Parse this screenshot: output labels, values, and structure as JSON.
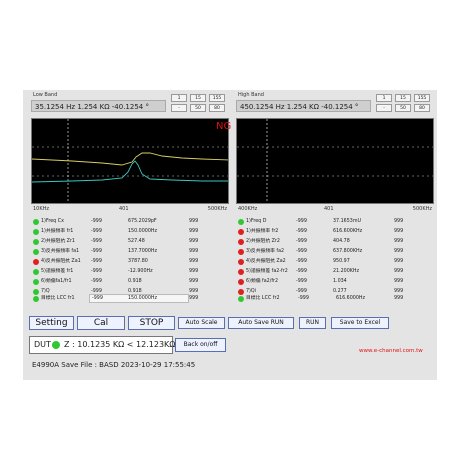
{
  "left_pane": {
    "title": "Low Band",
    "readout": "35.1254 Hz  1.254 KΩ  -40.1254 °",
    "scale_buttons": [
      "1",
      "15",
      "155",
      "-",
      "50",
      "80"
    ],
    "axis_min": "10KHz",
    "axis_mid": "401",
    "axis_max": "500KHz",
    "params": [
      {
        "status": "green",
        "name": "1)Freq Cx",
        "v1": "-999",
        "v2": "675.2029pF",
        "v3": "999"
      },
      {
        "status": "green",
        "name": "1)共振頻率 fr1",
        "v1": "-999",
        "v2": "150.0000Hz",
        "v3": "999"
      },
      {
        "status": "green",
        "name": "2)共振阻抗 Zr1",
        "v1": "-999",
        "v2": "527.48",
        "v3": "999"
      },
      {
        "status": "green",
        "name": "3)反共振頻率 fa1",
        "v1": "-999",
        "v2": "137.7000Hz",
        "v3": "999"
      },
      {
        "status": "red",
        "name": "4)反共振阻抗 Za1",
        "v1": "-999",
        "v2": "3787.80",
        "v3": "999"
      },
      {
        "status": "green",
        "name": "5)諧振頻差 fr1",
        "v1": "-999",
        "v2": "-12.900Hz",
        "v3": "999"
      },
      {
        "status": "green",
        "name": "6)頻偏fa1/fr1",
        "v1": "-999",
        "v2": "0.918",
        "v3": "999"
      },
      {
        "status": "green",
        "name": "7)Q",
        "v1": "-999",
        "v2": "0.918",
        "v3": "999"
      }
    ],
    "judge": {
      "status": "green",
      "label": "目標比 LCC fr1",
      "v1": "-999",
      "v2": "150.0000Hz",
      "v3": "999"
    }
  },
  "right_pane": {
    "title": "High Band",
    "readout": "450.1254 Hz  1.254 KΩ  -40.1254 °",
    "scale_buttons": [
      "1",
      "15",
      "155",
      "-",
      "50",
      "80"
    ],
    "axis_min": "400KHz",
    "axis_mid": "401",
    "axis_max": "500KHz",
    "params": [
      {
        "status": "green",
        "name": "1)Freq D",
        "v1": "-999",
        "v2": "37.1653mU",
        "v3": "999"
      },
      {
        "status": "red",
        "name": "1)共振頻率 fr2",
        "v1": "-999",
        "v2": "616.600KHz",
        "v3": "999"
      },
      {
        "status": "red",
        "name": "2)共振阻抗 Zr2",
        "v1": "-999",
        "v2": "404.78",
        "v3": "999"
      },
      {
        "status": "red",
        "name": "3)反共振頻率 fa2",
        "v1": "-999",
        "v2": "637.800KHz",
        "v3": "999"
      },
      {
        "status": "red",
        "name": "4)反共振阻抗 Za2",
        "v1": "-999",
        "v2": "950.97",
        "v3": "999"
      },
      {
        "status": "red",
        "name": "5)諧振頻差 fa2-fr2",
        "v1": "-999",
        "v2": "21.200KHz",
        "v3": "999"
      },
      {
        "status": "red",
        "name": "6)頻偏 fa2/fr2",
        "v1": "-999",
        "v2": "1.034",
        "v3": "999"
      },
      {
        "status": "red",
        "name": "7)Qi",
        "v1": "-999",
        "v2": "0.277",
        "v3": "999"
      }
    ],
    "judge": {
      "status": "green",
      "label": "目標比 LCC fr2",
      "v1": "-999",
      "v2": "616.6000Hz",
      "v3": "999"
    }
  },
  "ng_label": "NG",
  "toolbar": {
    "setting": "Setting",
    "cal": "Cal",
    "stop": "STOP",
    "auto_scale": "Auto Scale",
    "auto_save_run": "Auto Save RUN",
    "run": "RUN",
    "save_to_excel": "Save to Excel"
  },
  "dut": {
    "label": "DUT",
    "value": "Z : 10.1235 KΩ < 12.123KΩ"
  },
  "back_onoff": "Back on/off",
  "brand": "www.e-channel.com.tw",
  "status_line": "E4990A  Save File : BASD  2023-10-29 17:55:45",
  "colors": {
    "trace_yellow": "#d8d060",
    "trace_cyan": "#3ac8c0",
    "ok": "#2fc832",
    "ng": "#e01010"
  }
}
